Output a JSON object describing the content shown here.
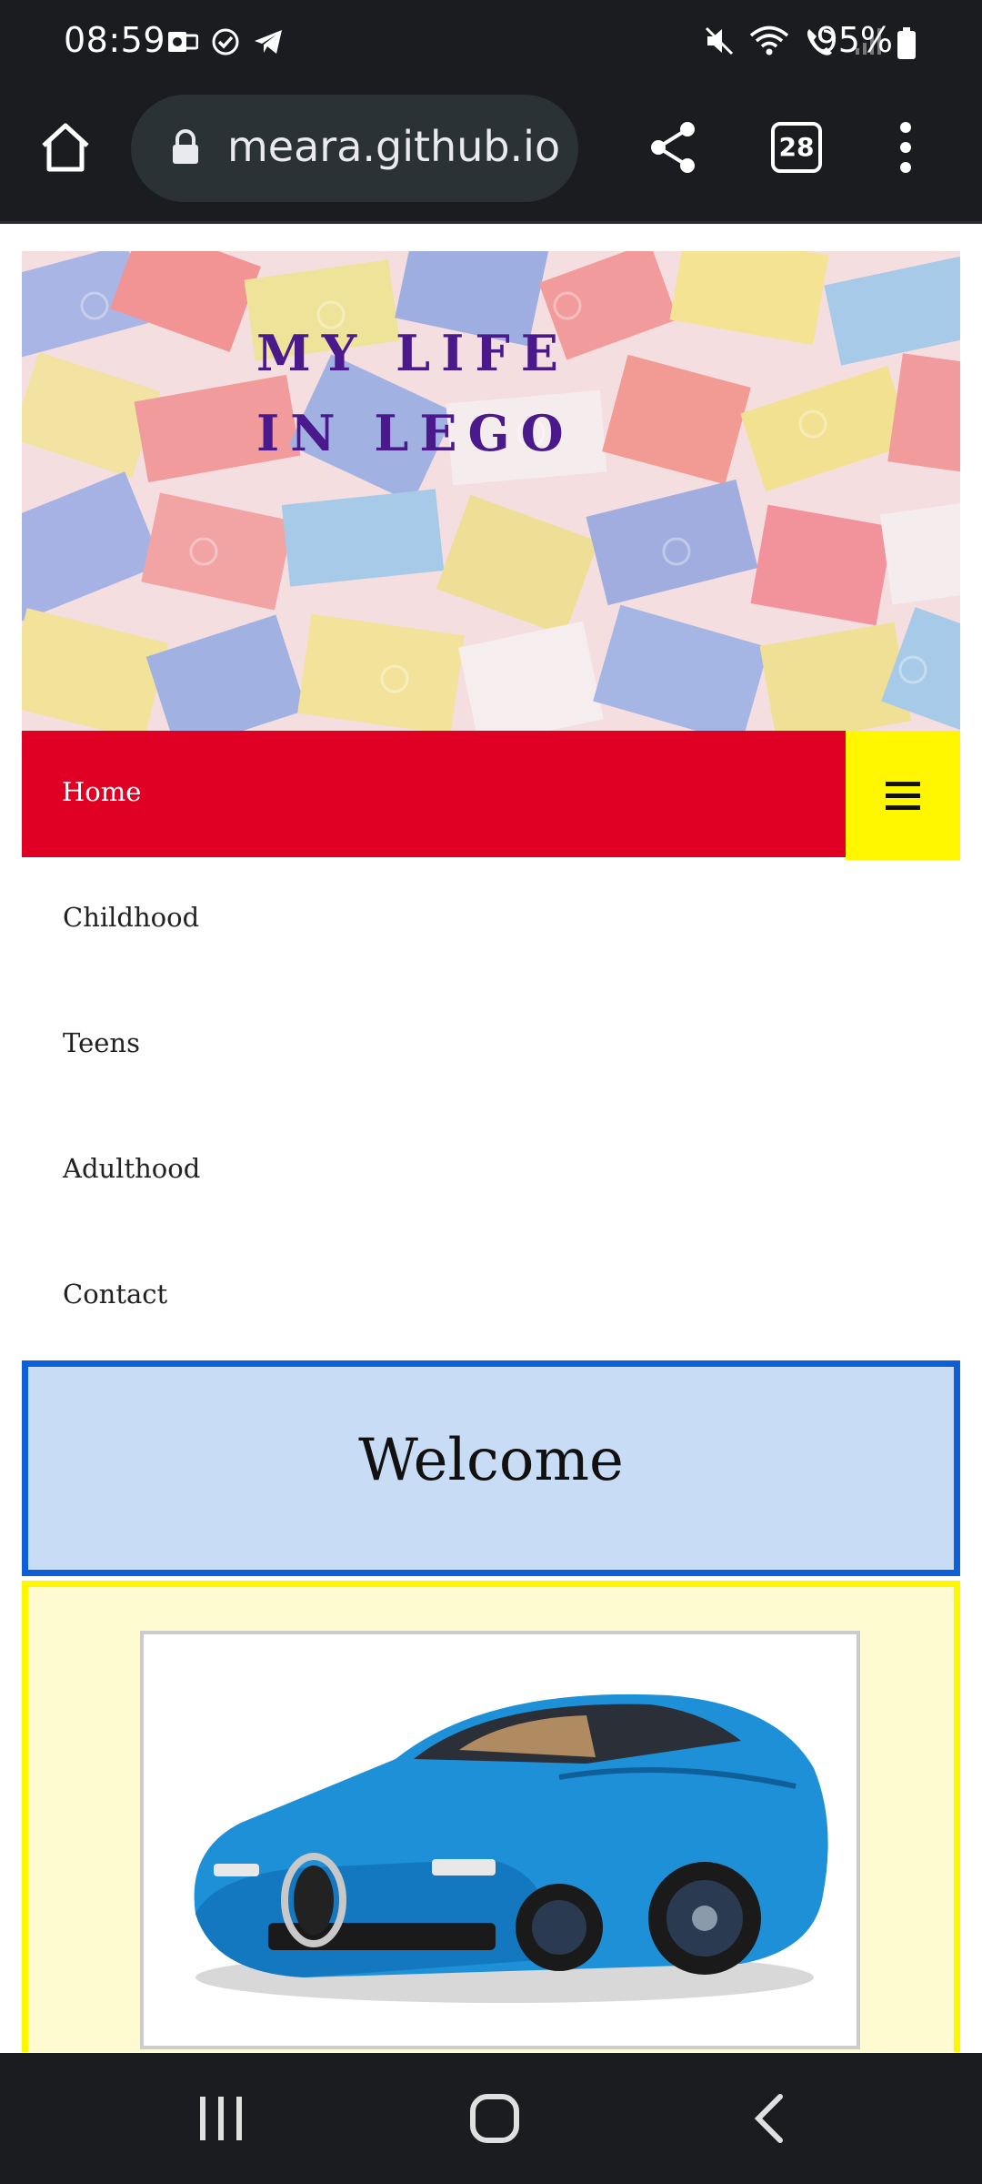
{
  "status_bar": {
    "time": "08:59",
    "battery_percent": "95%",
    "left_icons": [
      "outlook-icon",
      "check-circle-icon",
      "telegram-icon"
    ],
    "right_icons": [
      "mute-icon",
      "wifi-icon",
      "wifi-calling-icon",
      "signal-icon"
    ]
  },
  "browser": {
    "url": "meara.github.io",
    "tab_count": "28"
  },
  "site": {
    "title": "MY LIFE IN LEGO",
    "nav": {
      "home": "Home",
      "items": [
        "Childhood",
        "Teens",
        "Adulthood",
        "Contact"
      ]
    },
    "welcome": "Welcome"
  },
  "colors": {
    "nav_red": "#e00024",
    "hamburger_yellow": "#fff700",
    "welcome_blue_border": "#0c5fd6",
    "welcome_bg": "#c9dcf5",
    "gallery_bg": "#fffbd0",
    "title_purple": "#4a1a8c"
  }
}
